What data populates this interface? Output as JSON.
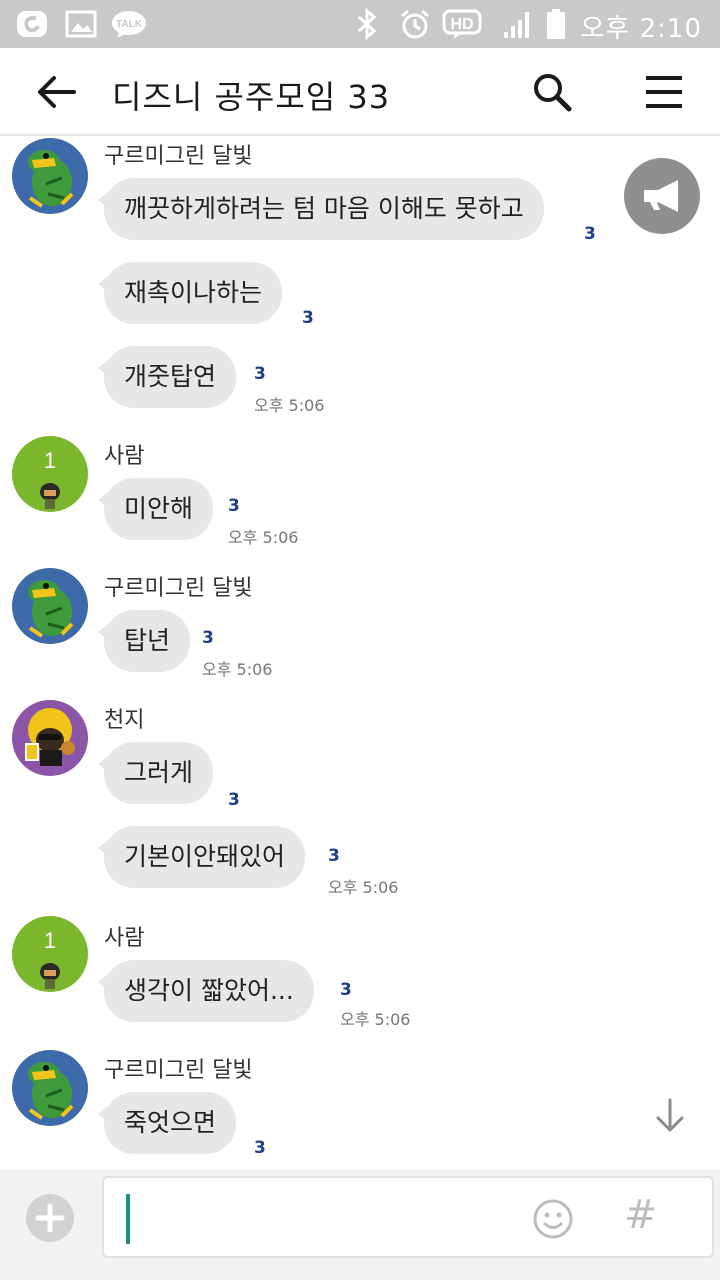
{
  "status_bar": {
    "time": "오후 2:10",
    "icons": [
      "olleh-icon",
      "gallery-icon",
      "talk-icon",
      "bluetooth-icon",
      "alarm-icon",
      "hd-voice-icon",
      "signal-icon",
      "battery-icon"
    ],
    "talk_badge": "TALK",
    "hd_badge": "HD"
  },
  "header": {
    "title": "디즈니 공주모임 33",
    "back_icon": "back-arrow-icon",
    "search_icon": "search-icon",
    "menu_icon": "hamburger-menu-icon"
  },
  "messages": [
    {
      "sender": "구르미그린 달빛",
      "text": "깨끗하게하려는 텀 마음 이해도 못하고",
      "unread": "3",
      "time": ""
    },
    {
      "sender": "",
      "text": "재촉이나하는",
      "unread": "3",
      "time": ""
    },
    {
      "sender": "",
      "text": "개줏탑연",
      "unread": "3",
      "time": "오후 5:06"
    },
    {
      "sender": "사람",
      "text": "미안해",
      "unread": "3",
      "time": "오후 5:06"
    },
    {
      "sender": "구르미그린 달빛",
      "text": "탑년",
      "unread": "3",
      "time": "오후 5:06"
    },
    {
      "sender": "천지",
      "text": "그러게",
      "unread": "3",
      "time": ""
    },
    {
      "sender": "",
      "text": "기본이안돼있어",
      "unread": "3",
      "time": "오후 5:06"
    },
    {
      "sender": "사람",
      "text": "생각이 짧았어...",
      "unread": "3",
      "time": "오후 5:06"
    },
    {
      "sender": "구르미그린 달빛",
      "text": "죽엇으면",
      "unread": "3",
      "time": ""
    }
  ],
  "avatar_badge": "1",
  "overlays": {
    "megaphone_icon": "megaphone-icon",
    "scroll_down_icon": "arrow-down-icon"
  },
  "input_bar": {
    "value": "",
    "plus_icon": "plus-icon",
    "emoji_icon": "emoticon-icon",
    "hash_label": "#"
  },
  "colors": {
    "status_bar": "#c9c9c9",
    "bubble": "#e7e7e7",
    "unread": "#1f3f8a",
    "caret": "#1b8f84",
    "green_avatar": "#7bb72c",
    "purple_avatar": "#8b55a8"
  }
}
